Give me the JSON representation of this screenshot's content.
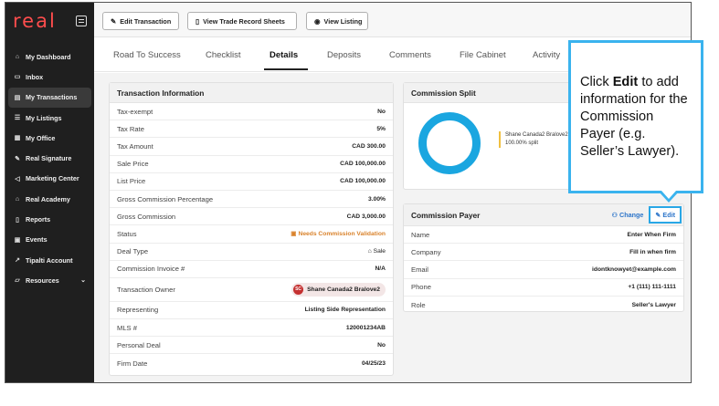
{
  "sidebar": {
    "logo": "real",
    "items": [
      {
        "label": "My Dashboard",
        "icon": "home-icon"
      },
      {
        "label": "Inbox",
        "icon": "inbox-icon"
      },
      {
        "label": "My Transactions",
        "icon": "transactions-icon"
      },
      {
        "label": "My Listings",
        "icon": "list-icon"
      },
      {
        "label": "My Office",
        "icon": "office-icon"
      },
      {
        "label": "Real Signature",
        "icon": "signature-icon"
      },
      {
        "label": "Marketing Center",
        "icon": "megaphone-icon"
      },
      {
        "label": "Real Academy",
        "icon": "academy-icon"
      },
      {
        "label": "Reports",
        "icon": "reports-icon"
      },
      {
        "label": "Events",
        "icon": "calendar-icon"
      },
      {
        "label": "Tipalti Account",
        "icon": "external-icon"
      },
      {
        "label": "Resources",
        "icon": "folder-icon"
      }
    ]
  },
  "toolbar": {
    "edit_transaction": "Edit Transaction",
    "view_trade_record": "View Trade Record Sheets",
    "view_listing": "View Listing"
  },
  "tabs": [
    "Road To Success",
    "Checklist",
    "Details",
    "Deposits",
    "Comments",
    "File Cabinet",
    "Activity"
  ],
  "transaction_info": {
    "title": "Transaction Information",
    "rows": [
      {
        "label": "Tax-exempt",
        "value": "No"
      },
      {
        "label": "Tax Rate",
        "value": "5%"
      },
      {
        "label": "Tax Amount",
        "value": "CAD 300.00"
      },
      {
        "label": "Sale Price",
        "value": "CAD 100,000.00"
      },
      {
        "label": "List Price",
        "value": "CAD 100,000.00"
      },
      {
        "label": "Gross Commission Percentage",
        "value": "3.00%"
      },
      {
        "label": "Gross Commission",
        "value": "CAD 3,000.00"
      },
      {
        "label": "Status",
        "value": "Needs Commission Validation"
      },
      {
        "label": "Deal Type",
        "value": "Sale"
      },
      {
        "label": "Commission Invoice #",
        "value": "N/A"
      },
      {
        "label": "Transaction Owner",
        "value": "Shane Canada2 Bralove2",
        "initials": "SC"
      },
      {
        "label": "Representing",
        "value": "Listing Side Representation"
      },
      {
        "label": "MLS #",
        "value": "120001234AB"
      },
      {
        "label": "Personal Deal",
        "value": "No"
      },
      {
        "label": "Firm Date",
        "value": "04/25/23"
      }
    ]
  },
  "commission_split": {
    "title": "Commission Split",
    "legend_name": "Shane Canada2 Bralove2",
    "legend_value": "100.00% split",
    "colors": {
      "ring": "#1aa6e0",
      "legend": "#f0c040"
    }
  },
  "commission_payer": {
    "title": "Commission Payer",
    "change_label": "Change",
    "edit_label": "Edit",
    "rows": [
      {
        "label": "Name",
        "value": "Enter When Firm"
      },
      {
        "label": "Company",
        "value": "Fill in when firm"
      },
      {
        "label": "Email",
        "value": "idontknowyet@example.com"
      },
      {
        "label": "Phone",
        "value": "+1 (111) 111-1111"
      },
      {
        "label": "Role",
        "value": "Seller's Lawyer"
      }
    ]
  },
  "callout": {
    "pre": "Click ",
    "bold": "Edit",
    "post": " to add information for the Commission Payer (e.g. Seller’s Lawyer)."
  }
}
